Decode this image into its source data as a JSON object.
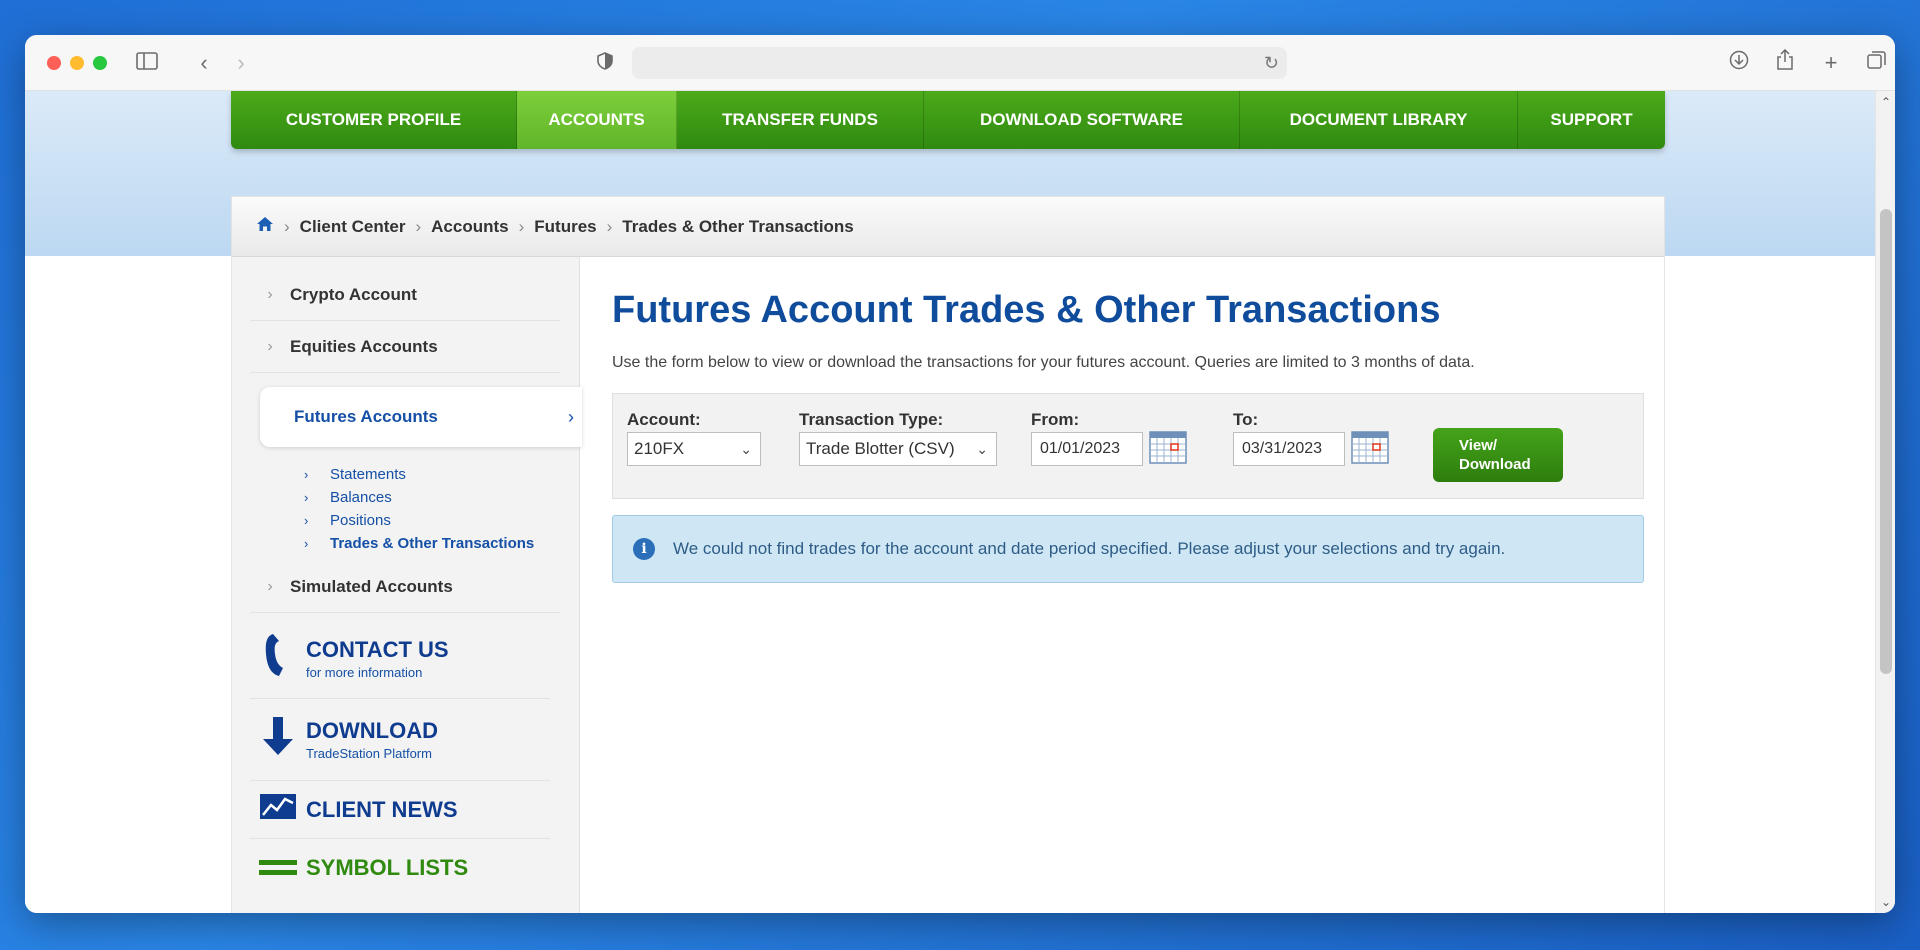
{
  "browser": {
    "url": ""
  },
  "nav": {
    "items": [
      {
        "label": "CUSTOMER PROFILE",
        "active": false
      },
      {
        "label": "ACCOUNTS",
        "active": true
      },
      {
        "label": "TRANSFER FUNDS",
        "active": false
      },
      {
        "label": "DOWNLOAD SOFTWARE",
        "active": false
      },
      {
        "label": "DOCUMENT LIBRARY",
        "active": false
      },
      {
        "label": "SUPPORT",
        "active": false
      }
    ]
  },
  "breadcrumb": [
    "Client Center",
    "Accounts",
    "Futures",
    "Trades & Other Transactions"
  ],
  "sidebar": {
    "items": [
      {
        "label": "Crypto Account"
      },
      {
        "label": "Equities Accounts"
      },
      {
        "label": "Futures Accounts"
      },
      {
        "label": "Simulated Accounts"
      }
    ],
    "sub_items": [
      {
        "label": "Statements"
      },
      {
        "label": "Balances"
      },
      {
        "label": "Positions"
      },
      {
        "label": "Trades & Other Transactions"
      }
    ],
    "promos": [
      {
        "title": "CONTACT US",
        "sub": "for more information"
      },
      {
        "title": "DOWNLOAD",
        "sub": "TradeStation Platform"
      },
      {
        "title": "CLIENT NEWS",
        "sub": ""
      },
      {
        "title": "SYMBOL LISTS",
        "sub": ""
      }
    ]
  },
  "main": {
    "title": "Futures Account Trades & Other Transactions",
    "description": "Use the form below to view or download the transactions for your futures account. Queries are limited to 3 months of data.",
    "form": {
      "account_label": "Account:",
      "account_value": "210FX",
      "type_label": "Transaction Type:",
      "type_value": "Trade Blotter (CSV)",
      "from_label": "From:",
      "from_value": "01/01/2023",
      "to_label": "To:",
      "to_value": "03/31/2023",
      "button_line1": "View/",
      "button_line2": "Download"
    },
    "alert": "We could not find trades for the account and date period specified. Please adjust your selections and try again."
  },
  "colors": {
    "nav_green": "#2f8a0f",
    "nav_active": "#6cc02f",
    "title_blue": "#0f4c9c",
    "alert_bg": "#cfe7f5"
  }
}
